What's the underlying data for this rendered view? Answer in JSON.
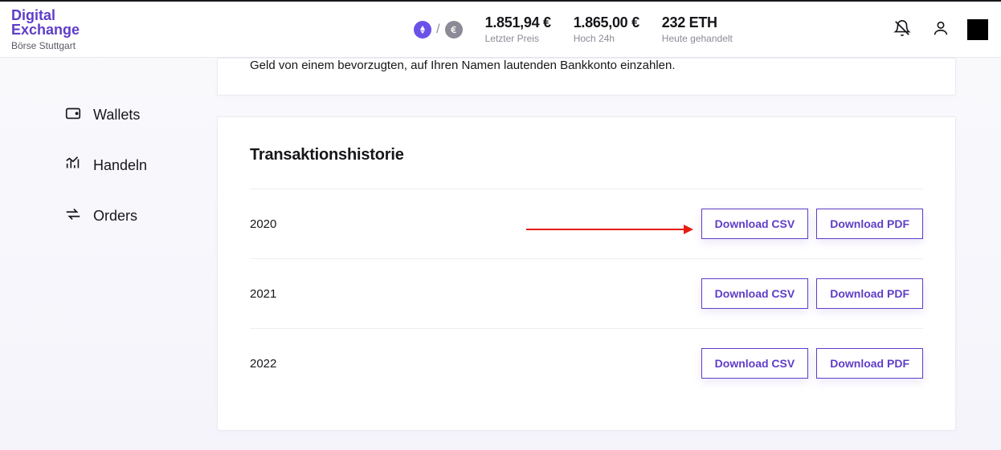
{
  "logo": {
    "line1": "Digital",
    "line2": "Exchange",
    "sub": "Börse Stuttgart"
  },
  "market": {
    "last_price": {
      "value": "1.851,94 €",
      "label": "Letzter Preis"
    },
    "high_24h": {
      "value": "1.865,00 €",
      "label": "Hoch 24h"
    },
    "volume": {
      "value": "232 ETH",
      "label": "Heute gehandelt"
    }
  },
  "sidebar": {
    "items": [
      {
        "label": "Wallets"
      },
      {
        "label": "Handeln"
      },
      {
        "label": "Orders"
      }
    ]
  },
  "banner": {
    "text": "Geld von einem bevorzugten, auf Ihren Namen lautenden Bankkonto einzahlen."
  },
  "history": {
    "title": "Transaktionshistorie",
    "csv_label": "Download CSV",
    "pdf_label": "Download PDF",
    "rows": [
      {
        "year": "2020"
      },
      {
        "year": "2021"
      },
      {
        "year": "2022"
      }
    ]
  }
}
